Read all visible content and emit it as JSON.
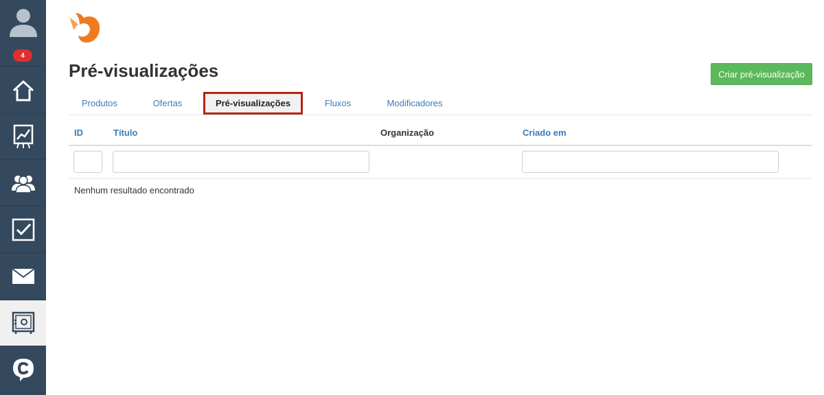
{
  "sidebar": {
    "notification_count": "4",
    "items": [
      {
        "name": "home"
      },
      {
        "name": "reports"
      },
      {
        "name": "people"
      },
      {
        "name": "tasks"
      },
      {
        "name": "mail"
      },
      {
        "name": "vault"
      },
      {
        "name": "chat"
      }
    ],
    "active_item": "vault"
  },
  "page": {
    "title": "Pré-visualizações",
    "create_button": "Criar pré-visualização"
  },
  "tabs": [
    {
      "label": "Produtos",
      "active": false
    },
    {
      "label": "Ofertas",
      "active": false
    },
    {
      "label": "Pré-visualizações",
      "active": true
    },
    {
      "label": "Fluxos",
      "active": false
    },
    {
      "label": "Modificadores",
      "active": false
    }
  ],
  "table": {
    "columns": [
      "ID",
      "Título",
      "Organização",
      "Criado em"
    ],
    "empty_message": "Nenhum resultado encontrado"
  },
  "colors": {
    "sidebar": "#34495e",
    "primary_button": "#5cb85c",
    "link": "#3a7bb8",
    "badge": "#e02f2f",
    "tab_highlight": "#b52412",
    "logo": "#f07a1f"
  }
}
